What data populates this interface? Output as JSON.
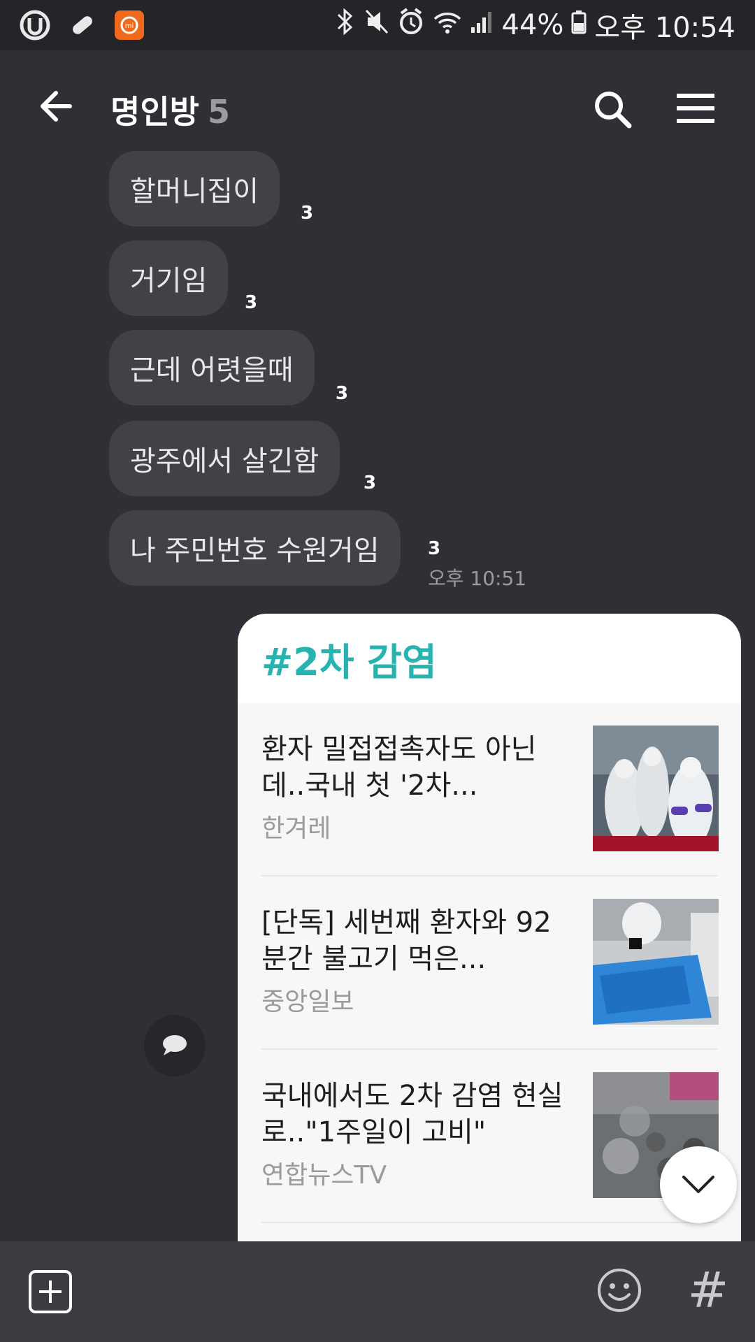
{
  "status_bar": {
    "battery": "44%",
    "time": "오후 10:54"
  },
  "header": {
    "title": "명인방",
    "member_count": "5"
  },
  "messages": [
    {
      "text": "할머니집이",
      "unread": "3"
    },
    {
      "text": "거기임",
      "unread": "3"
    },
    {
      "text": "근데 어렷을때",
      "unread": "3"
    },
    {
      "text": "광주에서 살긴함",
      "unread": "3"
    },
    {
      "text": "나 주민번호 수원거임",
      "unread": "3",
      "time": "오후 10:51"
    }
  ],
  "news_card": {
    "hashtag": "#2차 감염",
    "items": [
      {
        "title": "환자 밀접접촉자도 아닌데..국내 첫 '2차...",
        "source": "한겨레"
      },
      {
        "title": "[단독] 세번째 환자와 92분간 불고기 먹은...",
        "source": "중앙일보"
      },
      {
        "title": "국내에서도 2차 감염 현실로..\"1주일이 고비\"",
        "source": "연합뉴스TV"
      }
    ]
  },
  "input_bar": {
    "hash_label": "#"
  },
  "colors": {
    "background": "#2e3036",
    "bubble": "#404247",
    "hashtag": "#27b4b0",
    "input_bar": "#3b3d42"
  }
}
